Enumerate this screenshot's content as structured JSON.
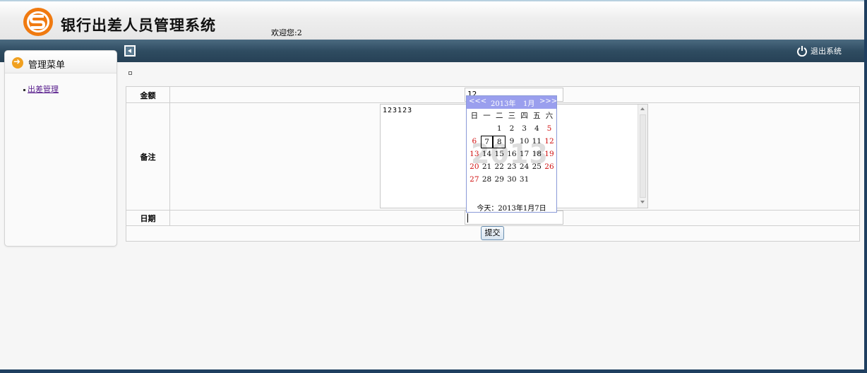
{
  "header": {
    "system_title": "银行出差人员管理系统",
    "welcome": "欢迎您:2",
    "logout_label": "退出系统"
  },
  "sidebar": {
    "title": "管理菜单",
    "items": [
      {
        "label": "出差管理"
      }
    ]
  },
  "form": {
    "amount_label": "金额",
    "amount_value": "12",
    "remark_label": "备注",
    "remark_value": "123123",
    "date_label": "日期",
    "date_value": "",
    "submit_label": "提交"
  },
  "calendar": {
    "prev": "<<<",
    "year": "2013年",
    "month": "1月",
    "next": ">>>",
    "watermark": "2013",
    "weekdays": [
      "日",
      "一",
      "二",
      "三",
      "四",
      "五",
      "六"
    ],
    "weeks": [
      [
        "",
        "",
        "1",
        "2",
        "3",
        "4",
        "5"
      ],
      [
        "6",
        "7",
        "8",
        "9",
        "10",
        "11",
        "12"
      ],
      [
        "13",
        "14",
        "15",
        "16",
        "17",
        "18",
        "19"
      ],
      [
        "20",
        "21",
        "22",
        "23",
        "24",
        "25",
        "26"
      ],
      [
        "27",
        "28",
        "29",
        "30",
        "31",
        "",
        ""
      ]
    ],
    "boxed_days": [
      "7",
      "8"
    ],
    "today_text": "今天：2013年1月7日"
  },
  "colors": {
    "topbar": "#2f4c61",
    "calendar_header": "#9a9fee",
    "weekend": "#d01010",
    "logo": "#f07a10"
  }
}
